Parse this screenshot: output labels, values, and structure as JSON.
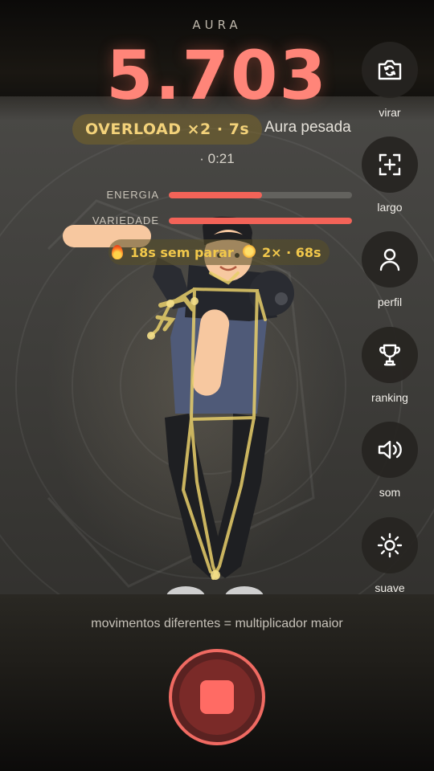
{
  "header": {
    "app_title": "AURA",
    "score": "5.703",
    "overload_badge": "OVERLOAD ×2 · 7s",
    "aura_mood": "Aura pesada",
    "timer": "· 0:21"
  },
  "meters": [
    {
      "label": "ENERGIA",
      "level": 0.51
    },
    {
      "label": "VARIEDADE",
      "level": 1.0
    }
  ],
  "streak": {
    "text": "18s sem parar",
    "multiplier_text": "2× · 68s"
  },
  "side_rail": [
    {
      "label": "virar",
      "icon": "camera-flip-icon"
    },
    {
      "label": "largo",
      "icon": "expand-frame-icon"
    },
    {
      "label": "perfil",
      "icon": "person-icon"
    },
    {
      "label": "ranking",
      "icon": "trophy-icon"
    },
    {
      "label": "som",
      "icon": "speaker-icon"
    },
    {
      "label": "suave",
      "icon": "sun-icon"
    }
  ],
  "hint": "movimentos diferentes = multiplicador maior",
  "record": {
    "state": "recording",
    "icon": "stop-icon"
  },
  "colors": {
    "accent": "#ff8579",
    "meter_fill": "#f36358",
    "badge_text": "#f3d27a",
    "streak_text": "#f2c84b",
    "record_border": "#f06a62"
  }
}
